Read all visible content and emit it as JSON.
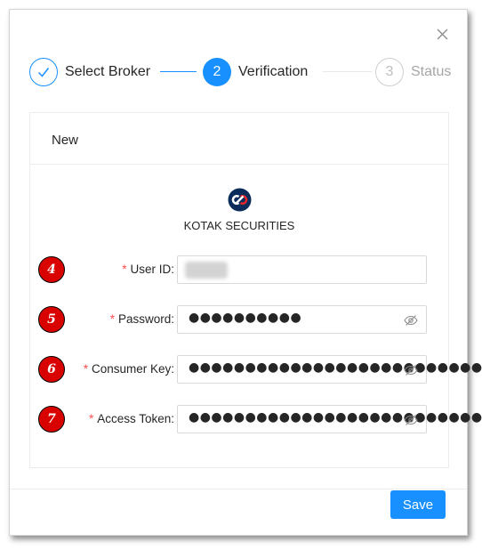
{
  "modal": {
    "steps": [
      {
        "number": "",
        "title": "Select Broker",
        "status": "done"
      },
      {
        "number": "2",
        "title": "Verification",
        "status": "active"
      },
      {
        "number": "3",
        "title": "Status",
        "status": "wait"
      }
    ],
    "card": {
      "title": "New",
      "broker_name": "KOTAK SECURITIES",
      "fields": [
        {
          "badge": "4",
          "required_mark": "*",
          "label": "User ID:",
          "value": ""
        },
        {
          "badge": "5",
          "required_mark": "*",
          "label": "Password:",
          "value": "●●●●●●●●●●"
        },
        {
          "badge": "6",
          "required_mark": "*",
          "label": "Consumer Key:",
          "value": "●●●●●●●●●●●●●●●●●●●●●●●●●●"
        },
        {
          "badge": "7",
          "required_mark": "*",
          "label": "Access Token:",
          "value": "●●●●●●●●●●●●●●●●●●●●●●●●●●"
        }
      ]
    },
    "save_label": "Save"
  },
  "colors": {
    "primary": "#1890ff",
    "required": "#ff4d4f",
    "badge": "#d90000",
    "logo": "#e4262c"
  }
}
